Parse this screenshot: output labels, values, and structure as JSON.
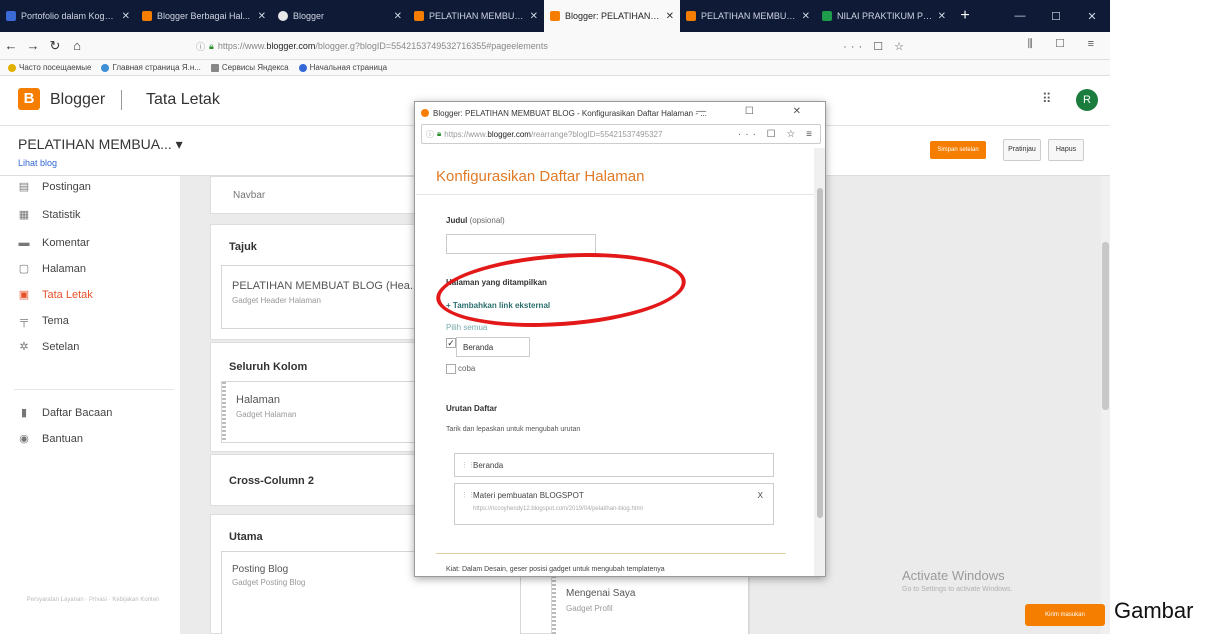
{
  "browser": {
    "tabs": [
      {
        "title": "Portofolio dalam Kogn...",
        "color": "#3c6bd8",
        "active": false
      },
      {
        "title": "Blogger Berbagai Hal...",
        "color": "#f57d00",
        "active": false
      },
      {
        "title": "Blogger",
        "color": "#e8e8e8",
        "active": false
      },
      {
        "title": "PELATIHAN MEMBUAT...",
        "color": "#f57d00",
        "active": false
      },
      {
        "title": "Blogger: PELATIHAN M...",
        "color": "#f57d00",
        "active": true
      },
      {
        "title": "PELATIHAN MEMBUAT...",
        "color": "#f57d00",
        "active": false
      },
      {
        "title": "NILAI PRAKTIKUM PEM...",
        "color": "#1e9d4a",
        "active": false
      }
    ],
    "new_tab": "+",
    "url_prefix": "https://www.",
    "url_domain": "blogger.com",
    "url_rest": "/blogger.g?blogID=5542153749532716355#pageelements",
    "url_actions": "··· ☐ ☆",
    "toolbar_right": "⫼ ☐ ≡",
    "bookmarks": [
      {
        "label": "Часто посещаемые",
        "color": "#e0b000"
      },
      {
        "label": "Главная страница Я.н...",
        "color": "#3d8fd6"
      },
      {
        "label": "Сервисы Яндекса",
        "color": "#888888"
      },
      {
        "label": "Начальная страница",
        "color": "#3367d6"
      }
    ]
  },
  "blogger": {
    "logo_letter": "B",
    "app_name": "Blogger",
    "section": "Tata Letak",
    "apps_icon": "⠿",
    "avatar_letter": "R",
    "blog_title": "PELATIHAN MEMBUA... ▾",
    "view_blog": "Lihat blog",
    "save_button": "Simpan setelan",
    "preview_button": "Pratinjau",
    "delete_button": "Hapus"
  },
  "sidebar": {
    "items": [
      {
        "label": "Postingan",
        "icon": "▤",
        "name": "posts"
      },
      {
        "label": "Statistik",
        "icon": "▦",
        "name": "stats"
      },
      {
        "label": "Komentar",
        "icon": "▬",
        "name": "comments"
      },
      {
        "label": "Halaman",
        "icon": "▢",
        "name": "pages"
      },
      {
        "label": "Tata Letak",
        "icon": "▣",
        "name": "layout",
        "active": true
      },
      {
        "label": "Tema",
        "icon": "╤",
        "name": "theme"
      },
      {
        "label": "Setelan",
        "icon": "✲",
        "name": "settings"
      },
      {
        "label": "Daftar Bacaan",
        "icon": "▮",
        "name": "reading-list"
      },
      {
        "label": "Bantuan",
        "icon": "◉",
        "name": "help"
      }
    ],
    "footer": "Persyaratan Layanan · Privasi · Kebijakan Konten"
  },
  "layout": {
    "navbar_label": "Navbar",
    "header_section": "Tajuk",
    "header_gadget_title": "PELATIHAN MEMBUAT BLOG (Hea...",
    "header_gadget_sub": "Gadget Header Halaman",
    "cross_section": "Seluruh Kolom",
    "pages_gadget_title": "Halaman",
    "pages_gadget_sub": "Gadget Halaman",
    "cross2_section": "Cross-Column 2",
    "main_section": "Utama",
    "blogpost_title": "Posting Blog",
    "blogpost_sub": "Gadget Posting Blog",
    "profile_title": "Mengenai Saya",
    "profile_sub": "Gadget Profil",
    "activate_title": "Activate Windows",
    "activate_sub": "Go to Settings to activate Windows.",
    "feedback_button": "Kirim masukan"
  },
  "popup": {
    "window_title": "Blogger: PELATIHAN MEMBUAT BLOG - Konfigurasikan Daftar Halaman - ...",
    "window_controls": "— ☐ ✕",
    "url_prefix": "https://www.",
    "url_domain": "blogger.com",
    "url_rest": "/rearrange?blogID=55421537495327",
    "url_actions": "··· ☐ ☆ ≡",
    "heading": "Konfigurasikan Daftar Halaman",
    "title_label": "Judul",
    "title_optional": "(opsional)",
    "title_value": "",
    "pages_label": "Halaman yang ditampilkan",
    "add_external_link": "+ Tambahkan link eksternal",
    "select_all": "Pilih semua",
    "page_beranda": "Beranda",
    "page_coba": "coba",
    "order_label": "Urutan Daftar",
    "order_instruction": "Tarik dan lepaskan untuk mengubah urutan",
    "order_items": [
      {
        "title": "Beranda",
        "url": ""
      },
      {
        "title": "Materi pembuatan BLOGSPOT",
        "url": "https://riccoyhendy12.blogspot.com/2019/04/pelatihan-blog.html"
      }
    ],
    "remove_icon": "X",
    "hint": "Kiat: Dalam Desain, geser posisi gadget untuk mengubah templatenya"
  },
  "caption": "Gambar"
}
